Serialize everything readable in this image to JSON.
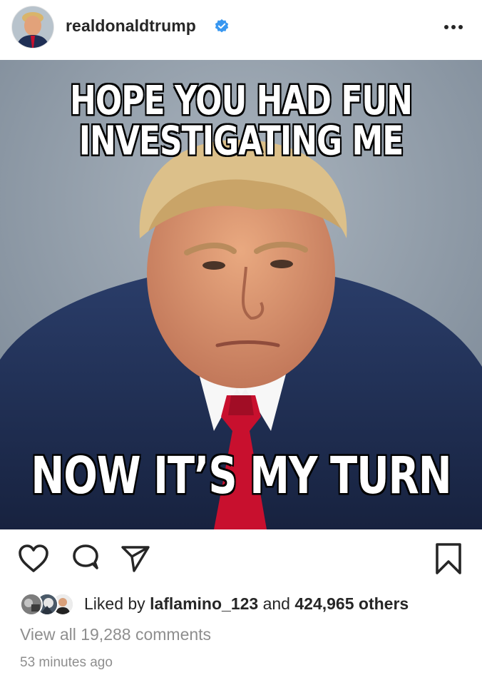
{
  "header": {
    "username": "realdonaldtrump",
    "verified": true,
    "avatar_icon": "profile-photo",
    "more_icon": "more-horizontal-icon"
  },
  "post": {
    "image_top_text_line1": "HOPE YOU HAD FUN",
    "image_top_text_line2": "INVESTIGATING ME",
    "image_bottom_text": "NOW IT’S MY TURN"
  },
  "actions": {
    "like_icon": "heart-icon",
    "comment_icon": "comment-icon",
    "share_icon": "paper-plane-icon",
    "save_icon": "bookmark-icon"
  },
  "likes": {
    "prefix": "Liked by",
    "first_liker": "laflamino_123",
    "connector": "and",
    "others": "424,965 others"
  },
  "comments": {
    "view_all": "View all 19,288 comments"
  },
  "timestamp": "53 minutes ago",
  "colors": {
    "verified_blue": "#3897f0",
    "text_primary": "#262626",
    "text_secondary": "#8e8e8e",
    "tie_red": "#c8102e",
    "suit_navy": "#1f2f55",
    "background_gray": "#8c9aa8"
  }
}
